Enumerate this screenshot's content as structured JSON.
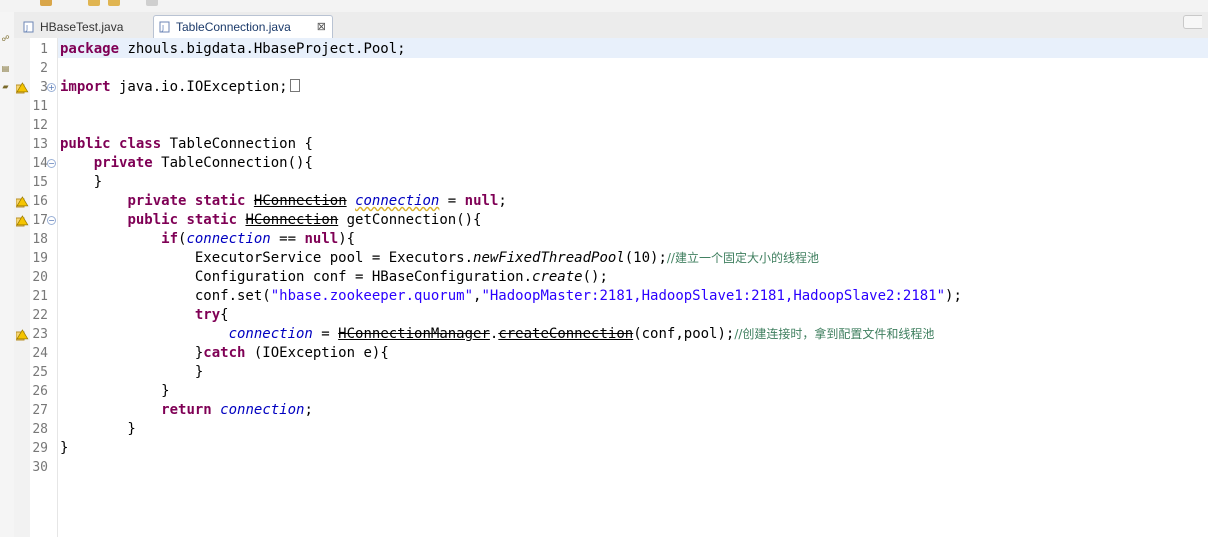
{
  "tabs": [
    {
      "label": "HBaseTest.java",
      "active": false
    },
    {
      "label": "TableConnection.java",
      "active": true,
      "close": "⊠"
    }
  ],
  "line_numbers": [
    "1",
    "2",
    "3",
    "11",
    "12",
    "13",
    "14",
    "15",
    "16",
    "17",
    "18",
    "19",
    "20",
    "21",
    "22",
    "23",
    "24",
    "25",
    "26",
    "27",
    "28",
    "29",
    "30"
  ],
  "code": {
    "l1": {
      "kw": "package",
      "rest": " zhouls.bigdata.HbaseProject.Pool;"
    },
    "l3": {
      "kw": "import",
      "rest": " java.io.IOException;"
    },
    "l13": {
      "kw1": "public",
      "kw2": "class",
      "rest": " TableConnection {"
    },
    "l14": {
      "indent": "    ",
      "kw": "private",
      "rest": " TableConnection(){"
    },
    "l15": {
      "text": "    }"
    },
    "l16": {
      "indent": "        ",
      "kw1": "private",
      "kw2": "static",
      "type": "HConnection",
      "field": "connection",
      "eq": " = ",
      "kw3": "null",
      "end": ";"
    },
    "l17": {
      "indent": "        ",
      "kw1": "public",
      "kw2": "static",
      "type": "HConnection",
      "rest": " getConnection(){"
    },
    "l18": {
      "indent": "            ",
      "kw": "if",
      "paren": "(",
      "field": "connection",
      "op": " == ",
      "kw2": "null",
      "end": "){"
    },
    "l19": {
      "indent": "                ",
      "pre": "ExecutorService pool = Executors.",
      "method": "newFixedThreadPool",
      "args": "(10);",
      "comment": "//建立一个固定大小的线程池"
    },
    "l20": {
      "indent": "                ",
      "pre": "Configuration conf = HBaseConfiguration.",
      "method": "create",
      "args": "();"
    },
    "l21": {
      "indent": "                ",
      "pre": "conf.set(",
      "s1": "\"hbase.zookeeper.quorum\"",
      "comma": ",",
      "s2": "\"HadoopMaster:2181,HadoopSlave1:2181,HadoopSlave2:2181\"",
      "end": ");"
    },
    "l22": {
      "indent": "                ",
      "kw": "try",
      "end": "{"
    },
    "l23": {
      "indent": "                    ",
      "field": "connection",
      "eq": " = ",
      "cls": "HConnectionManager",
      "dot": ".",
      "method": "createConnection",
      "args": "(conf,pool);",
      "comment": "//创建连接时，拿到配置文件和线程池"
    },
    "l24": {
      "indent": "                ",
      "pre": "}",
      "kw": "catch",
      "rest": " (IOException e){"
    },
    "l25": {
      "text": "                }"
    },
    "l26": {
      "text": "            }"
    },
    "l27": {
      "indent": "            ",
      "kw": "return",
      "sp": " ",
      "field": "connection",
      "end": ";"
    },
    "l28": {
      "text": "        }"
    },
    "l29": {
      "text": "}"
    }
  }
}
